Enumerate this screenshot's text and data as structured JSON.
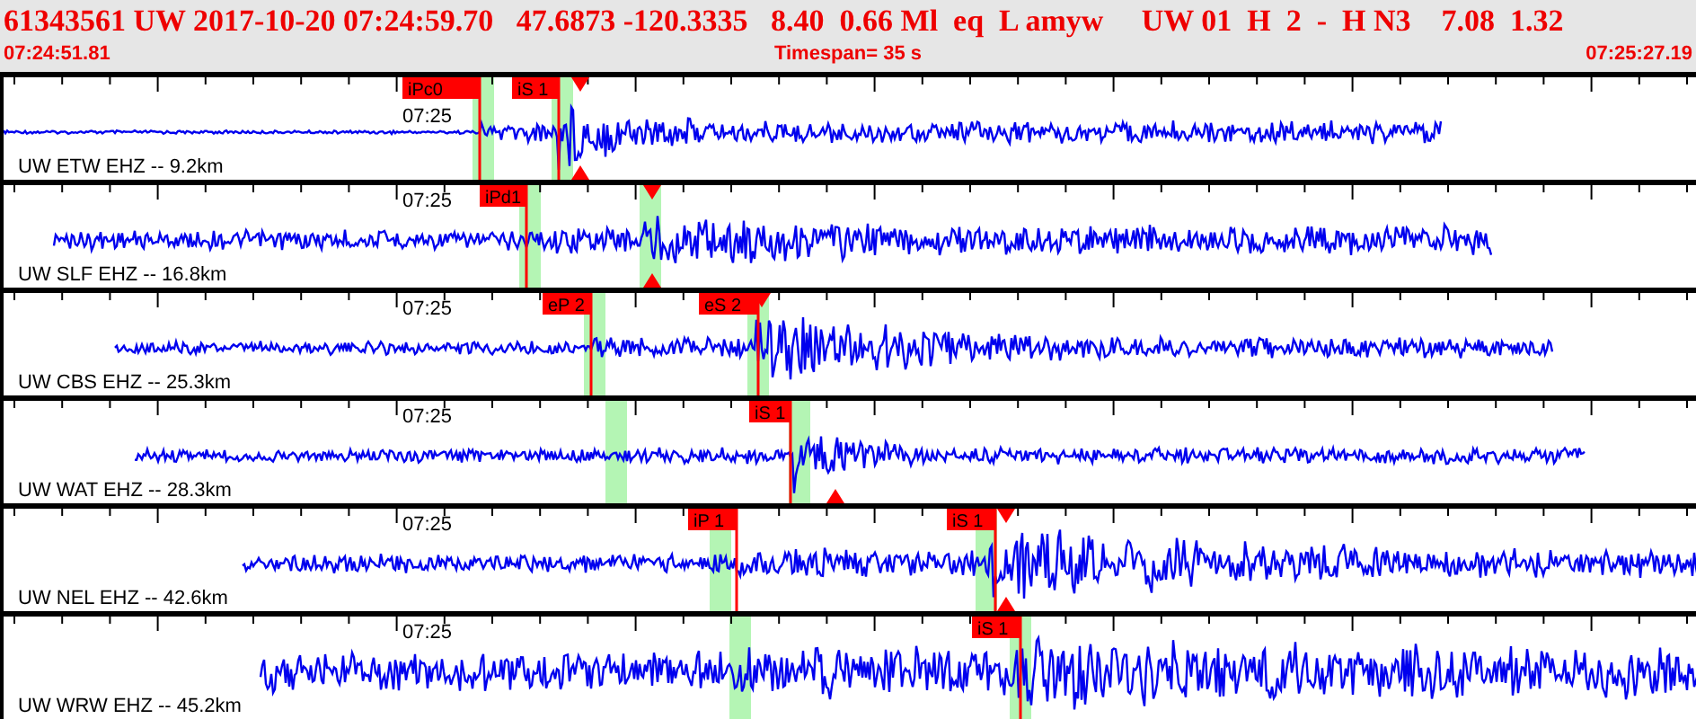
{
  "header": {
    "title": "61343561 UW 2017-10-20 07:24:59.70   47.6873 -120.3335   8.40  0.66 Ml  eq  L amyw     UW 01  H  2  -  H N3    7.08  1.32",
    "start_time": "07:24:51.81",
    "timespan": "Timespan=  35 s",
    "end_time": "07:25:27.19"
  },
  "traces": [
    {
      "label": "UW ETW EHZ -- 9.2km",
      "time_mark": "07:25",
      "picks": [
        {
          "label": "iPc0"
        },
        {
          "label": "iS 1"
        }
      ]
    },
    {
      "label": "UW SLF EHZ -- 16.8km",
      "time_mark": "07:25",
      "picks": [
        {
          "label": "iPd1"
        }
      ]
    },
    {
      "label": "UW CBS EHZ -- 25.3km",
      "time_mark": "07:25",
      "picks": [
        {
          "label": "eP 2"
        },
        {
          "label": "eS 2"
        }
      ]
    },
    {
      "label": "UW WAT EHZ -- 28.3km",
      "time_mark": "07:25",
      "picks": [
        {
          "label": "iS 1"
        }
      ]
    },
    {
      "label": "UW NEL EHZ -- 42.6km",
      "time_mark": "07:25",
      "picks": [
        {
          "label": "iP 1"
        },
        {
          "label": "iS 1"
        }
      ]
    },
    {
      "label": "UW WRW EHZ -- 45.2km",
      "time_mark": "07:25",
      "picks": [
        {
          "label": "iS 1"
        }
      ]
    }
  ]
}
